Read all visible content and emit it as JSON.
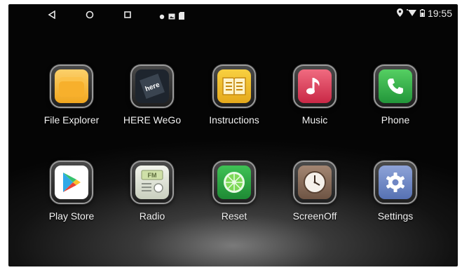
{
  "status": {
    "time": "19:55",
    "nav_icons": [
      "back-icon",
      "home-icon",
      "recents-icon"
    ],
    "notification_icons": [
      "dot-icon",
      "image-icon",
      "sdcard-icon"
    ],
    "right_icons": [
      "location-icon",
      "wifi-icon",
      "battery-icon"
    ]
  },
  "apps": [
    {
      "label": "File Explorer",
      "icon": "folder-icon",
      "color": "#f5b93a"
    },
    {
      "label": "HERE WeGo",
      "icon": "here-wego-icon",
      "color": "#2b3440",
      "logo_text": "here"
    },
    {
      "label": "Instructions",
      "icon": "book-icon",
      "color": "#f2c230"
    },
    {
      "label": "Music",
      "icon": "music-note-icon",
      "color": "#e0435e"
    },
    {
      "label": "Phone",
      "icon": "phone-icon",
      "color": "#34b64a"
    },
    {
      "label": "Play Store",
      "icon": "play-store-icon",
      "color": "#ffffff"
    },
    {
      "label": "Radio",
      "icon": "radio-icon",
      "color": "#dfe5d4",
      "logo_text": "FM"
    },
    {
      "label": "Reset",
      "icon": "lime-icon",
      "color": "#32a844"
    },
    {
      "label": "ScreenOff",
      "icon": "clock-icon",
      "color": "#8b6f5e"
    },
    {
      "label": "Settings",
      "icon": "gear-icon",
      "color": "#6f86c4"
    }
  ]
}
